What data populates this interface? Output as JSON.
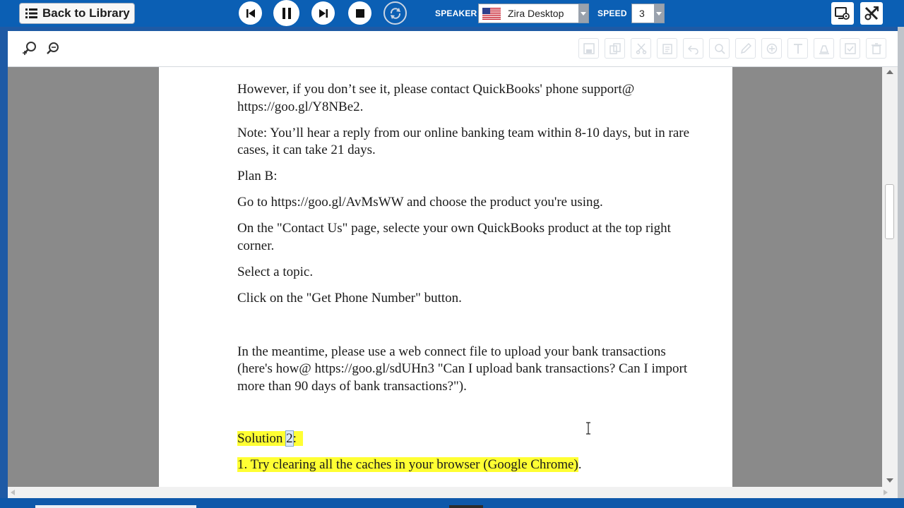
{
  "header": {
    "back_label": "Back to Library",
    "speaker_label": "SPEAKER",
    "speaker_value": "Zira Desktop",
    "speed_label": "SPEED",
    "speed_value": "3"
  },
  "document": {
    "paragraphs": [
      "However, if you don’t see it, please contact QuickBooks' phone support@ https://goo.gl/Y8NBe2.",
      "Note: You’ll hear a reply from our online banking team within 8-10 days, but in rare cases, it can take 21 days.",
      "Plan B:",
      "Go to https://goo.gl/AvMsWW and choose the product you're using.",
      "On the \"Contact Us\" page, selecte your own QuickBooks product at the top right corner.",
      "Select a topic.",
      "Click on the \"Get Phone Number\" button.",
      "In the meantime, please use a web connect file to upload your bank transactions (here's how@ https://goo.gl/sdUHn3 \"Can I upload bank transactions? Can I import more than 90 days of bank transactions?\")."
    ],
    "solution_prefix": "Solution ",
    "solution_number": "2",
    "solution_suffix": ":",
    "step1_text": "1. Try clearing all the caches in your browser (Google Chrome)",
    "step1_end": "."
  },
  "colors": {
    "topbar": "#0b5fb4",
    "highlight": "#ffff33",
    "viewer_bg": "#8a8a8a"
  },
  "icons": [
    "library-list-icon",
    "skip-previous-icon",
    "pause-icon",
    "skip-next-icon",
    "stop-icon",
    "repeat-sync-icon",
    "us-flag-icon",
    "dropdown-arrow-icon",
    "screen-settings-icon",
    "tools-icon",
    "zoom-in-icon",
    "zoom-out-icon",
    "save-icon",
    "copy-icon",
    "cut-icon",
    "paste-icon",
    "undo-icon",
    "find-icon",
    "edit-icon",
    "add-icon",
    "text-icon",
    "highlight-icon",
    "check-icon",
    "delete-icon",
    "text-cursor-icon"
  ]
}
